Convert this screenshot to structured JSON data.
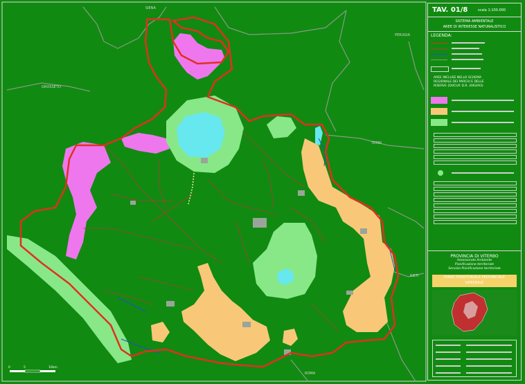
{
  "panel": {
    "tav": "TAV. 01/8",
    "scale": "scala 1:100.000",
    "subtitle_1": "SISTEMA AMBIENTALE",
    "subtitle_2": "AREE DI INTERESSE NATURALISTICO",
    "legend_title": "LEGENDA:",
    "aree_text_1": "AREE INCLUSE NELLO SCHEMA",
    "aree_text_2": "REGIONALE DEI PARCHI E DELLE",
    "aree_text_3": "RISERVE (DOCUP. D.R. 2063/93)",
    "provincia_title": "PROVINCIA DI VITERBO",
    "provincia_sub_1": "Assessorato Ambiente",
    "provincia_sub_2": "Pianificazione territoriale",
    "provincia_sub_3": "Servizio Pianificazione territoriale",
    "piano_1": "PIANO TERRITORIALE PROVINCIALE",
    "piano_2": "GENERALE"
  },
  "map_labels": {
    "siena": "SIENA",
    "perugia": "PERUGIA",
    "grosseto": "GROSSETO",
    "terni": "TERNI",
    "rieti": "RIETI",
    "roma": "ROMA",
    "scale_0": "0",
    "scale_5": "5",
    "scale_10": "10km"
  },
  "colors": {
    "background": "#118a11",
    "region_pink": "#ee77ee",
    "region_orange": "#f8c878",
    "region_lightgreen": "#88e888",
    "lake": "#66e8ee",
    "boundary_red": "#e03020",
    "river_blue": "#2050d0"
  }
}
